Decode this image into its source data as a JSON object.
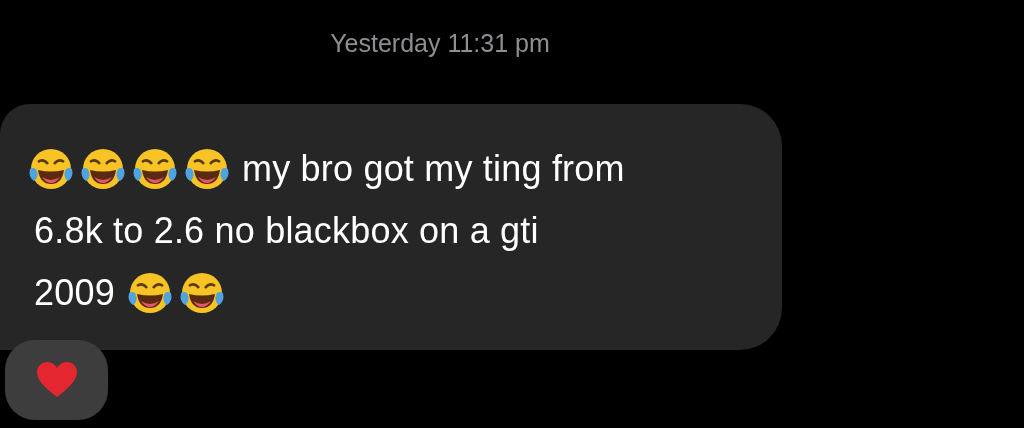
{
  "timestamp": "Yesterday 11:31 pm",
  "message": {
    "lines": [
      {
        "parts": [
          {
            "kind": "emoji"
          },
          {
            "kind": "emoji"
          },
          {
            "kind": "emoji"
          },
          {
            "kind": "emoji"
          },
          {
            "kind": "text",
            "text": "my bro got my ting from"
          }
        ]
      },
      {
        "parts": [
          {
            "kind": "text",
            "text": "6.8k to 2.6 no blackbox on a gti"
          }
        ]
      },
      {
        "parts": [
          {
            "kind": "text",
            "text": "2009"
          },
          {
            "kind": "emoji"
          },
          {
            "kind": "emoji"
          }
        ]
      }
    ],
    "reaction": {
      "kind": "heart"
    }
  }
}
